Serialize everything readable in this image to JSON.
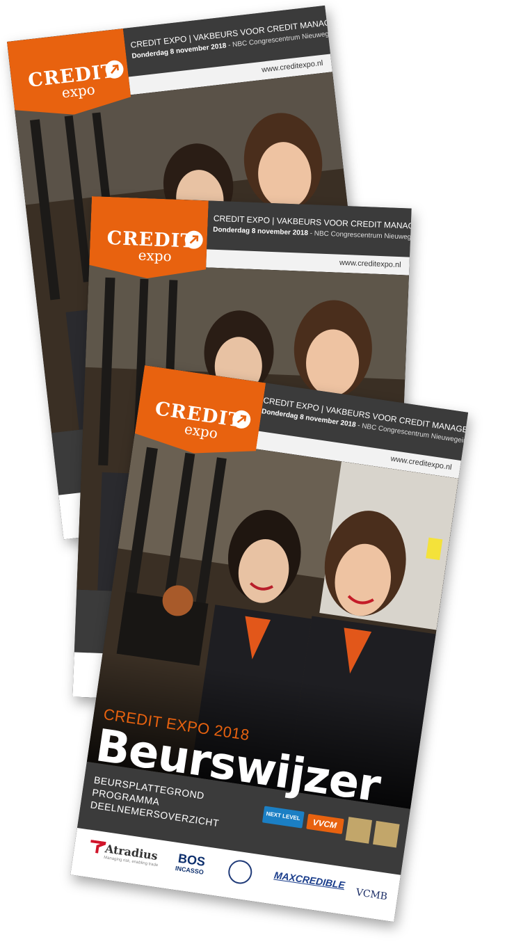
{
  "brand": {
    "word": "CREDIT",
    "sub": "expo"
  },
  "header": {
    "line1": "CREDIT EXPO | VAKBEURS VOOR CREDIT MANAGEMENT",
    "line2_bold": "Donderdag 8 november 2018",
    "line2_rest": " - NBC Congrescentrum Nieuwegein",
    "url": "www.creditexpo.nl"
  },
  "front": {
    "kicker": "CREDIT EXPO 2018",
    "title": "Beurswijzer",
    "lines": [
      "BEURSPLATTEGROND",
      "PROGRAMMA",
      "DEELNEMERSOVERZICHT"
    ]
  },
  "partners": [
    "NEXT LEVEL",
    "VVCM"
  ],
  "sponsors": {
    "atradius": "Atradius",
    "atradius_tag": "Managing risk, enabling trade",
    "bos": "BOS",
    "bos_sub": "INCASSO",
    "maxcredible": "MAXCREDIBLE",
    "vcmb": "VCMB"
  },
  "colors": {
    "orange": "#e8620f",
    "dark": "#3b3b3b"
  }
}
